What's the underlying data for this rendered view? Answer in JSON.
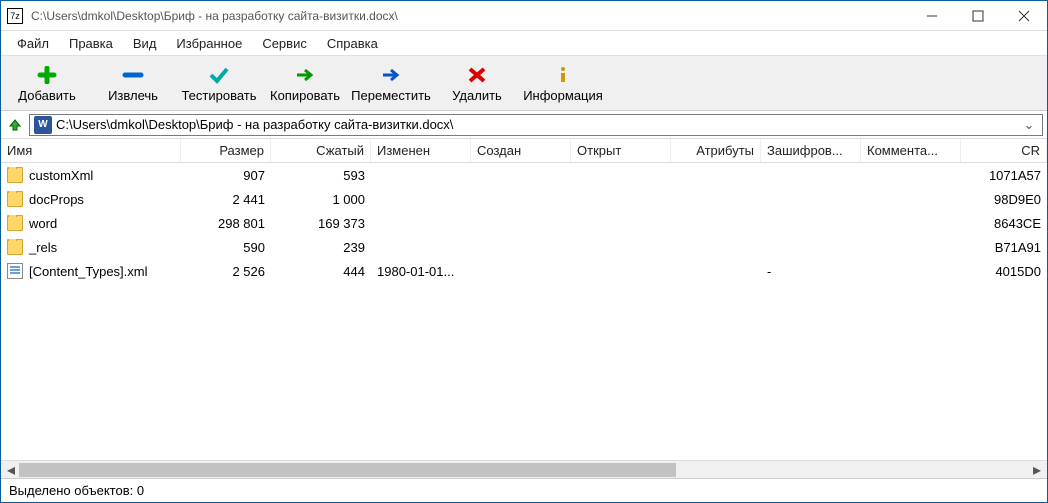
{
  "window": {
    "title": "C:\\Users\\dmkol\\Desktop\\Бриф - на разработку сайта-визитки.docx\\"
  },
  "menu": {
    "file": "Файл",
    "edit": "Правка",
    "view": "Вид",
    "favorites": "Избранное",
    "tools": "Сервис",
    "help": "Справка"
  },
  "toolbar": {
    "add": "Добавить",
    "extract": "Извлечь",
    "test": "Тестировать",
    "copy": "Копировать",
    "move": "Переместить",
    "delete": "Удалить",
    "info": "Информация"
  },
  "path": {
    "value": "C:\\Users\\dmkol\\Desktop\\Бриф - на разработку сайта-визитки.docx\\"
  },
  "columns": {
    "name": "Имя",
    "size": "Размер",
    "packed": "Сжатый",
    "modified": "Изменен",
    "created": "Создан",
    "accessed": "Открыт",
    "attr": "Атрибуты",
    "enc": "Зашифров...",
    "comment": "Коммента...",
    "crc": "CR"
  },
  "rows": [
    {
      "name": "customXml",
      "type": "folder",
      "size": "907",
      "packed": "593",
      "modified": "",
      "enc": "",
      "crc": "1071A57"
    },
    {
      "name": "docProps",
      "type": "folder",
      "size": "2 441",
      "packed": "1 000",
      "modified": "",
      "enc": "",
      "crc": "98D9E0"
    },
    {
      "name": "word",
      "type": "folder",
      "size": "298 801",
      "packed": "169 373",
      "modified": "",
      "enc": "",
      "crc": "8643CE"
    },
    {
      "name": "_rels",
      "type": "folder",
      "size": "590",
      "packed": "239",
      "modified": "",
      "enc": "",
      "crc": "B71A91"
    },
    {
      "name": "[Content_Types].xml",
      "type": "file",
      "size": "2 526",
      "packed": "444",
      "modified": "1980-01-01...",
      "enc": "-",
      "crc": "4015D0"
    }
  ],
  "status": {
    "text": "Выделено объектов: 0"
  }
}
